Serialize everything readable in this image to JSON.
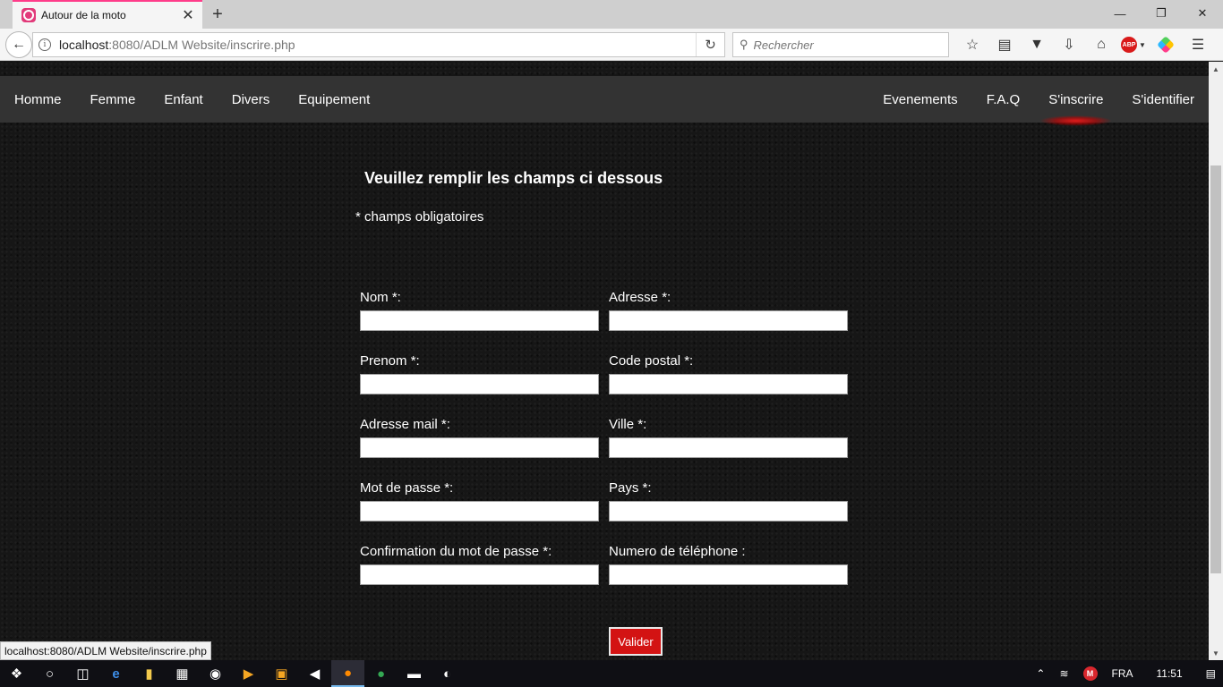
{
  "browser": {
    "tab_title": "Autour de la moto",
    "url_host": "localhost",
    "url_rest": ":8080/ADLM Website/inscrire.php",
    "search_placeholder": "Rechercher",
    "status_url": "localhost:8080/ADLM Website/inscrire.php"
  },
  "site_nav": {
    "left": [
      "Homme",
      "Femme",
      "Enfant",
      "Divers",
      "Equipement"
    ],
    "right": [
      "Evenements",
      "F.A.Q",
      "S'inscrire",
      "S'identifier"
    ],
    "active": "S'inscrire"
  },
  "form": {
    "title": "Veuillez remplir les champs ci dessous",
    "required_note": "* champs obligatoires",
    "fields_left": [
      {
        "label": "Nom *:",
        "value": ""
      },
      {
        "label": "Prenom *:",
        "value": ""
      },
      {
        "label": "Adresse mail *:",
        "value": ""
      },
      {
        "label": "Mot de passe *:",
        "value": ""
      },
      {
        "label": "Confirmation du mot de passe *:",
        "value": ""
      }
    ],
    "fields_right": [
      {
        "label": "Adresse *:",
        "value": ""
      },
      {
        "label": "Code postal *:",
        "value": ""
      },
      {
        "label": "Ville *:",
        "value": ""
      },
      {
        "label": "Pays *:",
        "value": ""
      },
      {
        "label": "Numero de téléphone :",
        "value": ""
      }
    ],
    "submit_label": "Valider"
  },
  "taskbar": {
    "language": "FRA",
    "time": "11:51"
  },
  "colors": {
    "accent_red": "#d31313",
    "nav_bg": "#333333",
    "page_bg": "#161616"
  }
}
